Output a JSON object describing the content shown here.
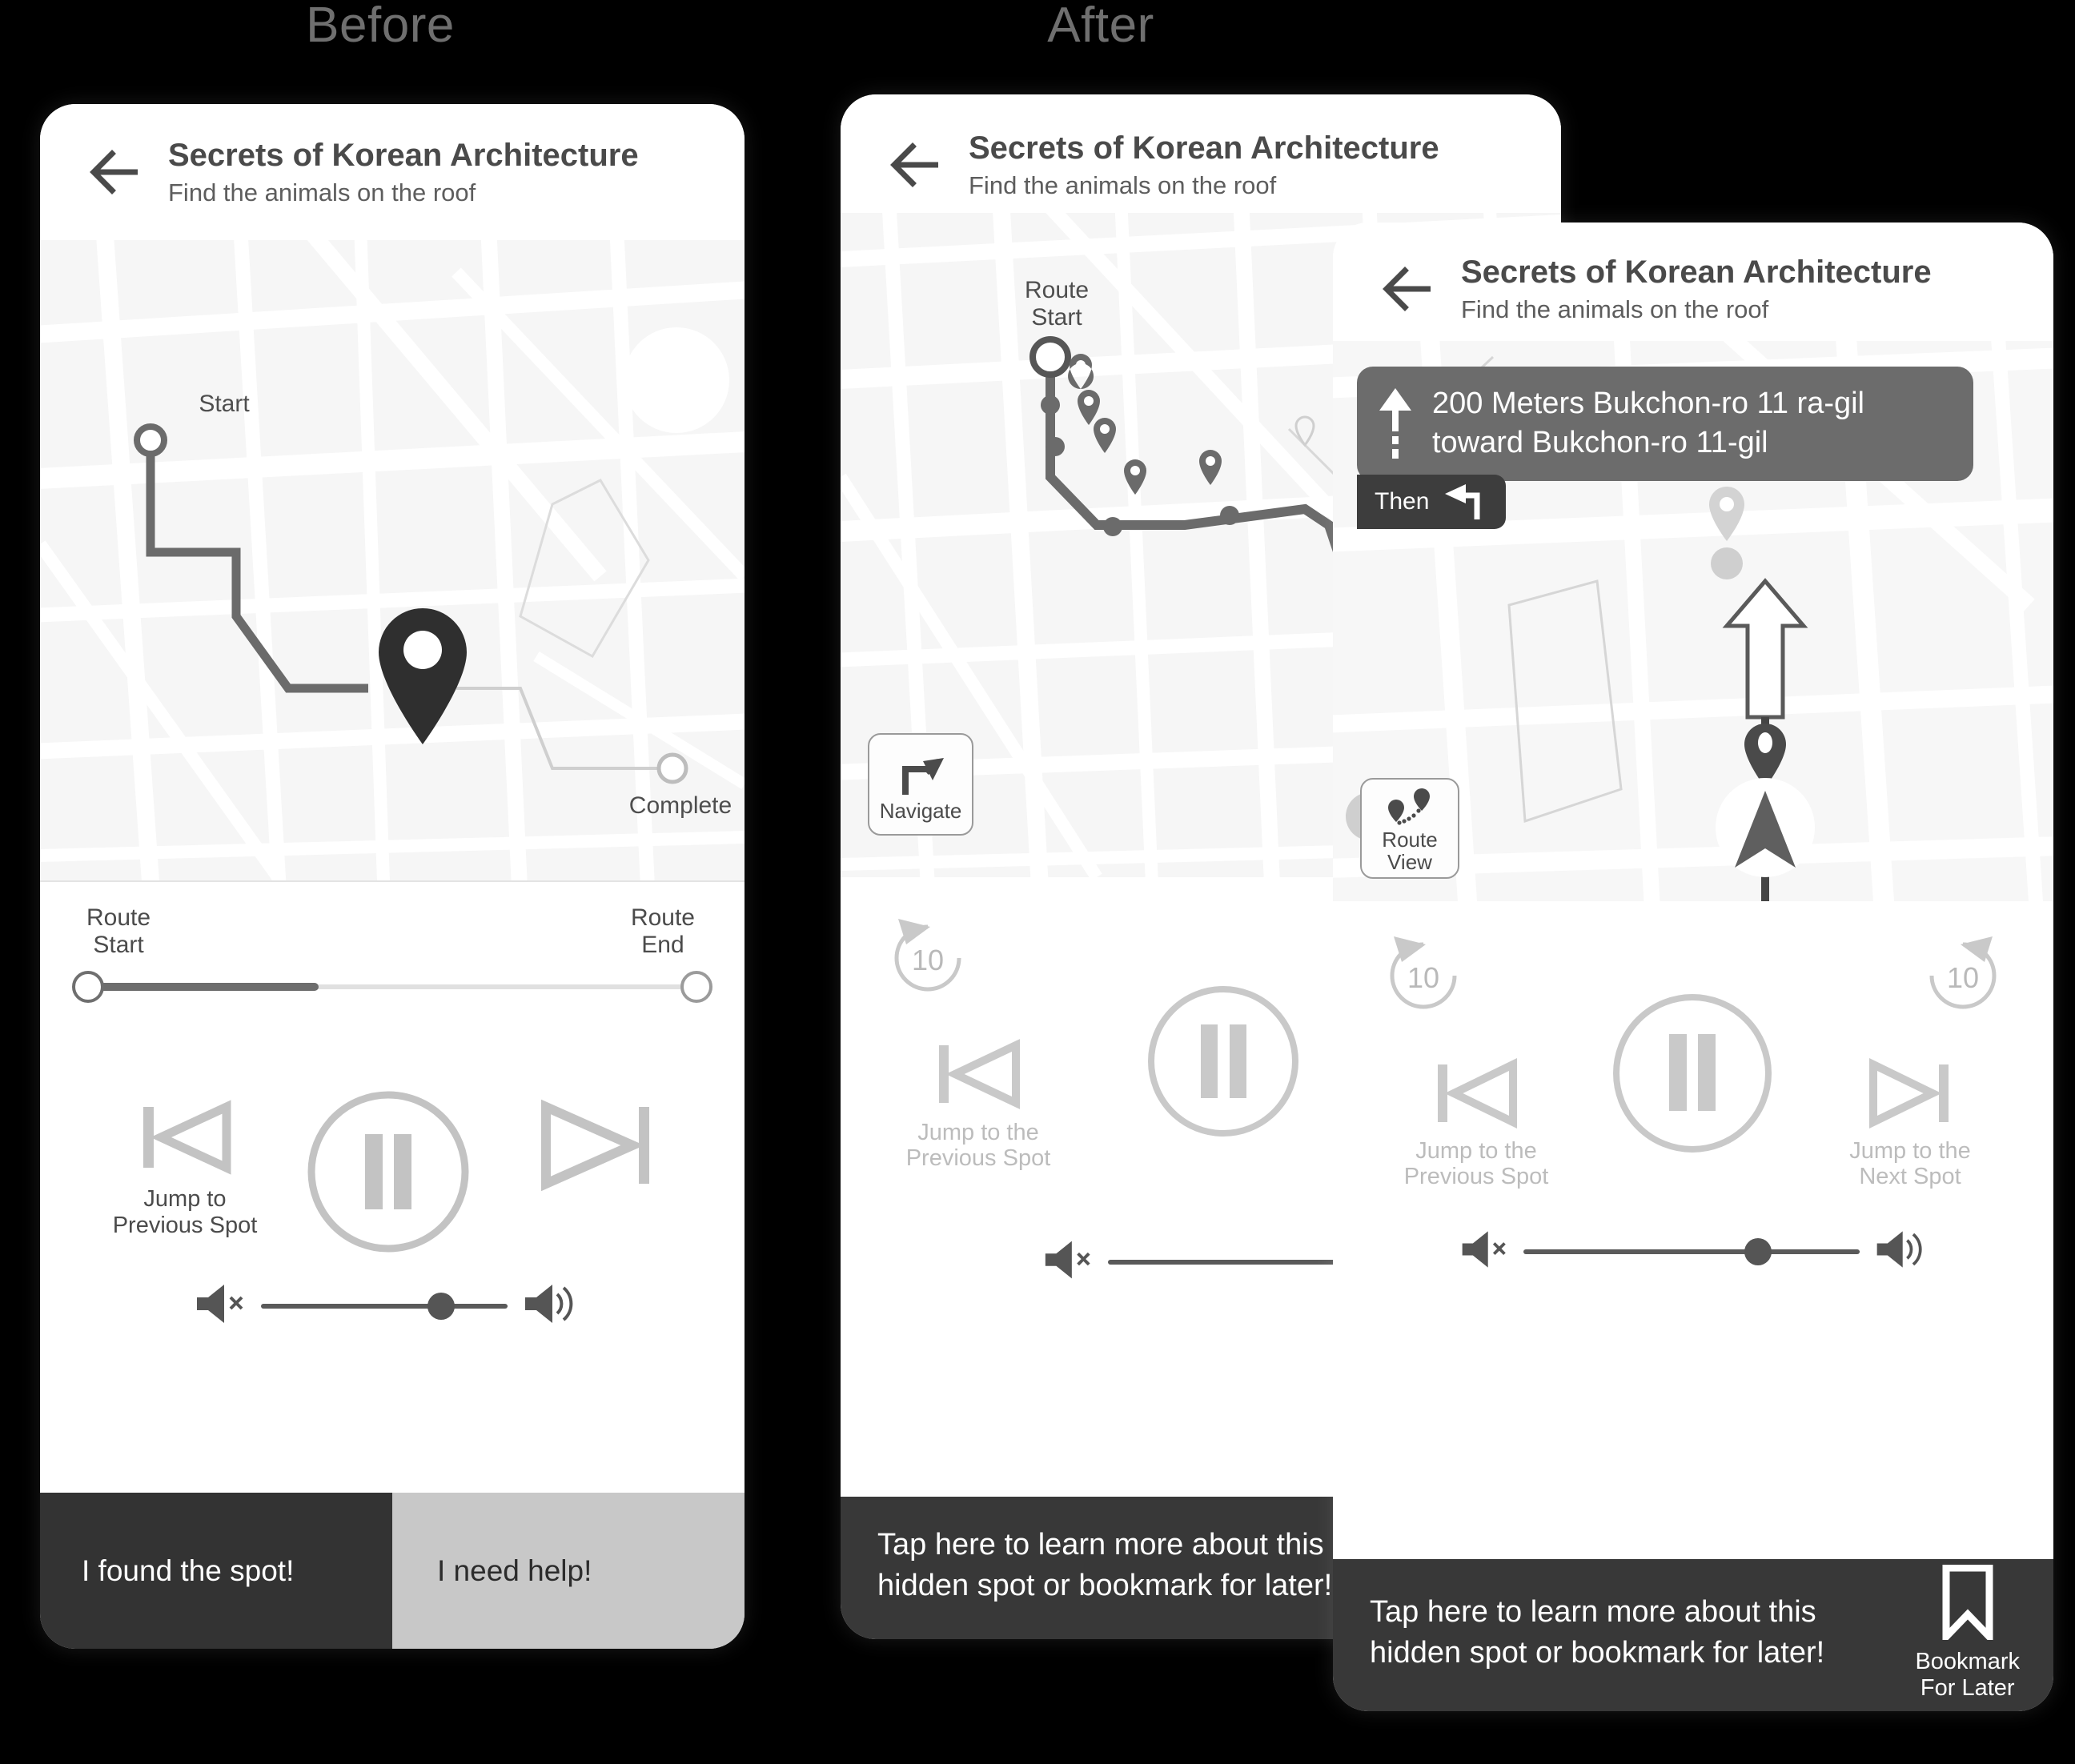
{
  "sections": {
    "before_title": "Before",
    "after_title": "After"
  },
  "header": {
    "title": "Secrets of Korean Architecture",
    "subtitle": "Find the animals on the roof",
    "back_icon": "back-arrow-icon"
  },
  "before_phone": {
    "map": {
      "start_label": "Start",
      "complete_label": "Complete",
      "pin_icon": "map-pin-icon"
    },
    "route_slider": {
      "start_label": "Route\nStart",
      "end_label": "Route\nEnd",
      "fill_percent": 38,
      "start_knob_percent": 0,
      "end_knob_percent": 100
    },
    "controls": {
      "prev_label": "Jump to\nPrevious Spot",
      "prev_icon": "skip-previous-icon",
      "play_pause_icon": "pause-icon",
      "next_icon": "skip-next-icon",
      "next_label": ""
    },
    "volume": {
      "mute_icon": "volume-mute-icon",
      "max_icon": "volume-high-icon",
      "value_percent": 72
    },
    "bottom": {
      "found_label": "I found the spot!",
      "help_label": "I need help!"
    }
  },
  "after_phone_1": {
    "map": {
      "route_start_label": "Route\nStart",
      "walker_icon": "pedestrian-icon",
      "navigate_button": {
        "label": "Navigate",
        "icon": "turn-right-arrow-icon"
      }
    },
    "controls": {
      "rewind_label": "10",
      "rewind_icon": "replay-10-icon",
      "prev_label": "Jump to the\nPrevious Spot",
      "prev_icon": "skip-previous-icon",
      "play_pause_icon": "pause-icon"
    },
    "volume": {
      "mute_icon": "volume-mute-icon",
      "value_percent": 77
    },
    "bottom": {
      "learn_message": "Tap here to learn more about this\nhidden spot or bookmark for later!"
    }
  },
  "after_phone_2": {
    "nav_banner": {
      "instruction": "200 Meters Bukchon-ro 11 ra-gil\ntoward Bukchon-ro 11-gil",
      "straight_icon": "straight-arrow-icon",
      "then_label": "Then",
      "then_icon": "turn-left-arrow-icon"
    },
    "map": {
      "route_view_button": {
        "label": "Route\nView",
        "icon": "route-pins-icon"
      },
      "position_icon": "navigation-cursor-icon",
      "pin_icon": "map-pin-icon"
    },
    "controls": {
      "rewind_label": "10",
      "rewind_icon": "replay-10-icon",
      "forward_label": "10",
      "forward_icon": "forward-10-icon",
      "prev_label": "Jump to the\nPrevious Spot",
      "prev_icon": "skip-previous-icon",
      "next_label": "Jump to the\nNext Spot",
      "next_icon": "skip-next-icon",
      "play_pause_icon": "pause-icon"
    },
    "volume": {
      "mute_icon": "volume-mute-icon",
      "max_icon": "volume-high-icon",
      "value_percent": 70
    },
    "bottom": {
      "learn_message": "Tap here to learn more about this\nhidden spot or bookmark for later!",
      "bookmark_label": "Bookmark\nFor Later",
      "bookmark_icon": "bookmark-icon"
    }
  },
  "colors": {
    "background": "#000000",
    "dark_button": "#333333",
    "light_button": "#c8c8c8",
    "banner": "#6c6c6c",
    "then_banner": "#3d3d3d",
    "bottom_bar": "#383838",
    "map_base": "#f6f6f6",
    "route_line": "#6d6d6d",
    "ghost_text": "#bcbcbc"
  }
}
